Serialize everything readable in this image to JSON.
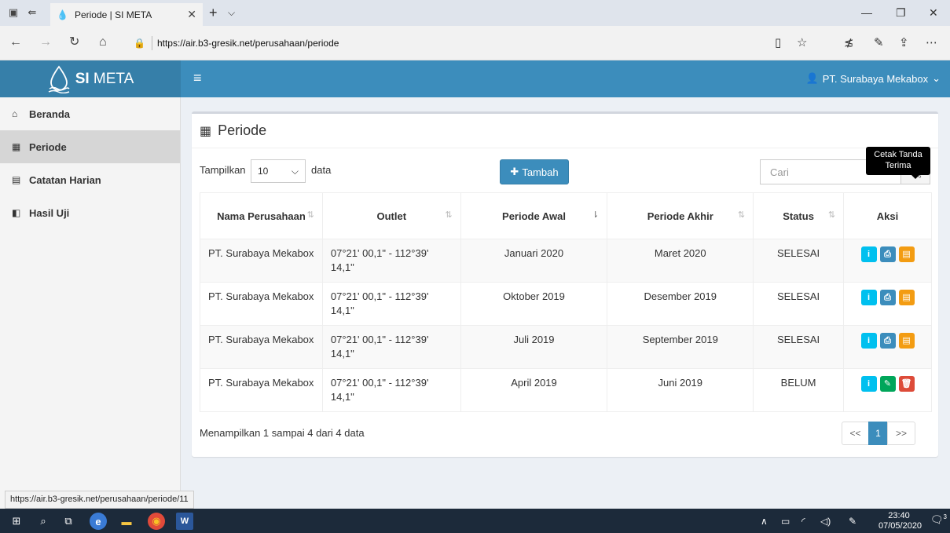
{
  "browser": {
    "tab_title": "Periode | SI META",
    "url": "https://air.b3-gresik.net/perusahaan/periode",
    "status_url": "https://air.b3-gresik.net/perusahaan/periode/11"
  },
  "header": {
    "brand_bold": "SI",
    "brand_rest": " META",
    "user": "PT. Surabaya Mekabox"
  },
  "sidebar": {
    "items": [
      {
        "label": "Beranda",
        "icon": "home-icon"
      },
      {
        "label": "Periode",
        "icon": "calendar-icon"
      },
      {
        "label": "Catatan Harian",
        "icon": "file-icon"
      },
      {
        "label": "Hasil Uji",
        "icon": "files-icon"
      }
    ]
  },
  "page": {
    "title": "Periode",
    "show_label": "Tampilkan",
    "show_value": "10",
    "show_suffix": "data",
    "add_label": "Tambah",
    "search_placeholder": "Cari",
    "tooltip": "Cetak Tanda Terima",
    "info": "Menampilkan 1 sampai 4 dari 4 data"
  },
  "table": {
    "headers": [
      "Nama Perusahaan",
      "Outlet",
      "Periode Awal",
      "Periode Akhir",
      "Status",
      "Aksi"
    ],
    "rows": [
      {
        "company": "PT. Surabaya Mekabox",
        "outlet": "07°21' 00,1\" - 112°39' 14,1\"",
        "start": "Januari 2020",
        "end": "Maret 2020",
        "status": "SELESAI"
      },
      {
        "company": "PT. Surabaya Mekabox",
        "outlet": "07°21' 00,1\" - 112°39' 14,1\"",
        "start": "Oktober 2019",
        "end": "Desember 2019",
        "status": "SELESAI"
      },
      {
        "company": "PT. Surabaya Mekabox",
        "outlet": "07°21' 00,1\" - 112°39' 14,1\"",
        "start": "Juli 2019",
        "end": "September 2019",
        "status": "SELESAI"
      },
      {
        "company": "PT. Surabaya Mekabox",
        "outlet": "07°21' 00,1\" - 112°39' 14,1\"",
        "start": "April 2019",
        "end": "Juni 2019",
        "status": "BELUM"
      }
    ]
  },
  "pagination": {
    "prev": "<<",
    "current": "1",
    "next": ">>"
  },
  "taskbar": {
    "time": "23:40",
    "date": "07/05/2020",
    "notifications": "3"
  },
  "colors": {
    "primary": "#3c8dbc",
    "info": "#00c0ef",
    "warning": "#f39c12",
    "success": "#00a65a",
    "danger": "#dd4b39"
  }
}
